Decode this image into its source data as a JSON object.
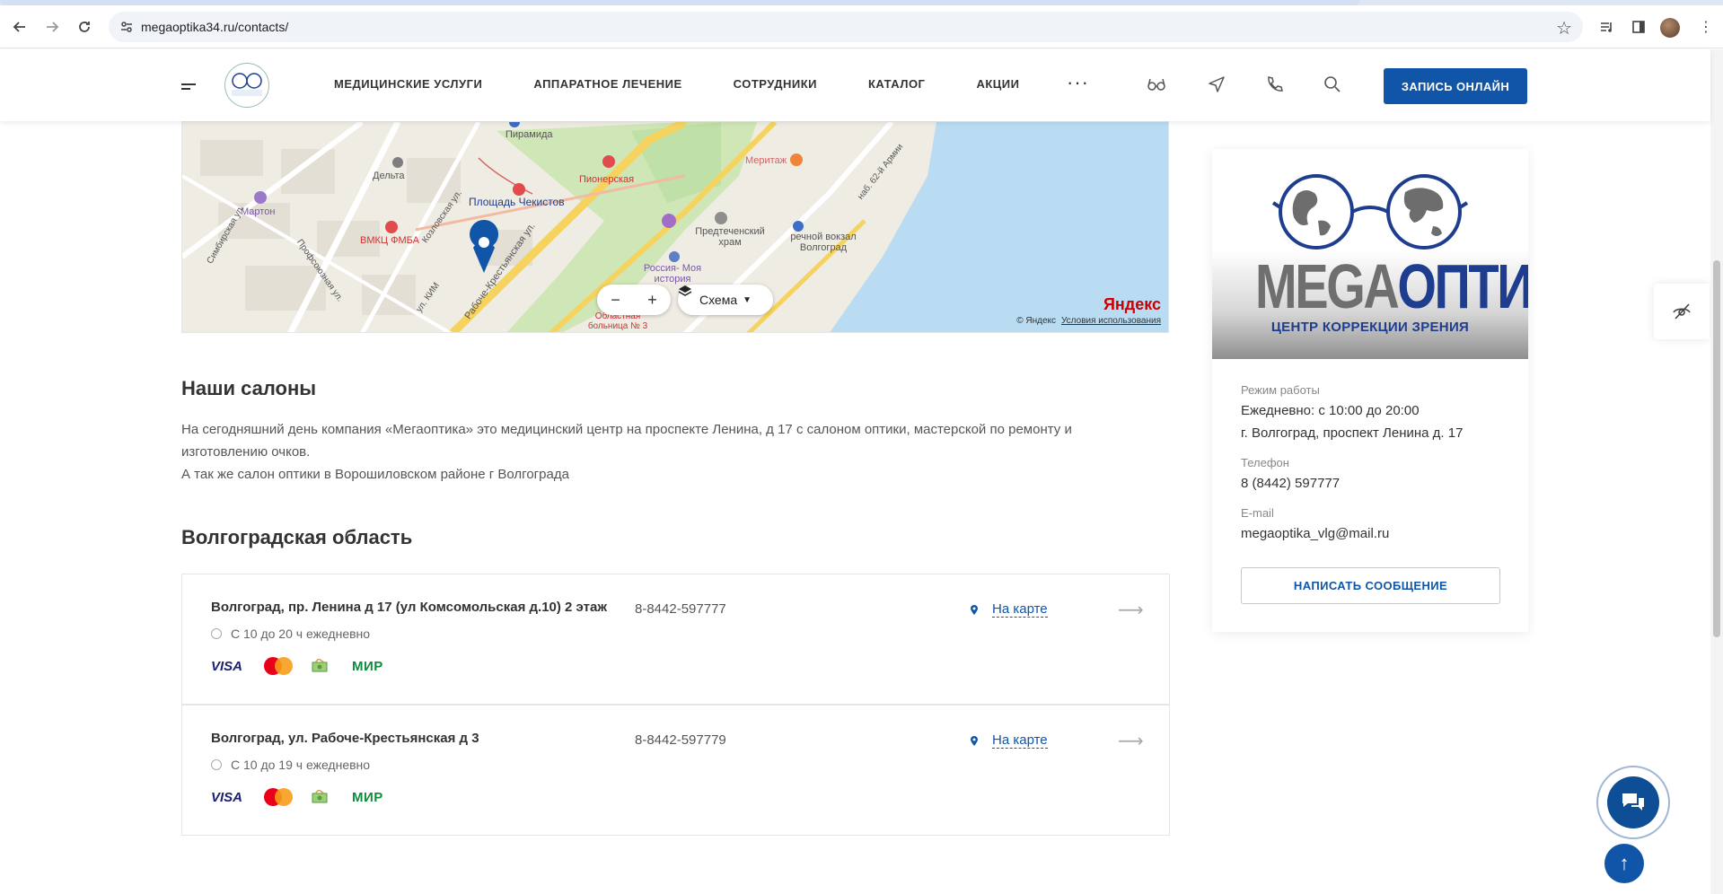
{
  "browser": {
    "url": "megaoptika34.ru/contacts/"
  },
  "header": {
    "nav": [
      "МЕДИЦИНСКИЕ УСЛУГИ",
      "АППАРАТНОЕ ЛЕЧЕНИЕ",
      "СОТРУДНИКИ",
      "КАТАЛОГ",
      "АКЦИИ"
    ],
    "more": "···",
    "cta": "ЗАПИСЬ ОНЛАЙН",
    "brand_color": "#1155a8"
  },
  "map": {
    "labels": {
      "piramida": "Пирамида",
      "delta": "Дельта",
      "pionerskaya": "Пионерская",
      "meritazh": "Меритаж",
      "martoon": "Мартон",
      "ploshad": "Площадь Чекистов",
      "vmkc": "ВМКЦ ФМБА",
      "predt": "Предтеченский храм",
      "vokzal": "речной вокзал Волгоград",
      "rossia": "Россия- Моя история",
      "bolnica": "Областная больница № 3",
      "kozlov": "Козловская ул.",
      "rab": "Рабоче-Крестьянская ул.",
      "kim": "ул. КИМ",
      "prof": "Профсоюзная ул.",
      "simb": "Симбирская ул.",
      "nab": "наб. 62-й Армии"
    },
    "zoom_out": "−",
    "zoom_in": "+",
    "scheme": "Схема",
    "yandex": "Яндекс",
    "copyright": "© Яндекс",
    "terms": "Условия использования"
  },
  "salons_section": {
    "title": "Наши салоны",
    "paragraph_1": "На сегодняшний день компания «Мегаоптика» это медицинский центр на проспекте Ленина, д 17 с салоном оптики, мастерской по ремонту и изготовлению очков.",
    "paragraph_2": "А так же салон оптики в Ворошиловском районе г Волгограда"
  },
  "region": {
    "title": "Волгоградская область",
    "salons": [
      {
        "address": "Волгоград, пр. Ленина д 17 (ул Комсомольская д.10) 2 этаж",
        "phone": "8-8442-597777",
        "hours": "С 10 до 20 ч ежедневно",
        "map_link": "На карте"
      },
      {
        "address": "Волгоград, ул. Рабоче-Крестьянская д 3",
        "phone": "8-8442-597779",
        "hours": "С 10 до 19 ч ежедневно",
        "map_link": "На карте"
      }
    ],
    "payments": [
      "VISA",
      "МИР"
    ]
  },
  "card": {
    "brand_a": "MEGA",
    "brand_b": "ОПТИКА",
    "tagline": "ЦЕНТР КОРРЕКЦИИ ЗРЕНИЯ",
    "hours_label": "Режим работы",
    "hours": "Ежедневно: с 10:00 до 20:00",
    "address": "г. Волгоград, проспект Ленина д. 17",
    "phone_label": "Телефон",
    "phone": "8 (8442) 597777",
    "email_label": "E-mail",
    "email": "megaoptika_vlg@mail.ru",
    "button": "НАПИСАТЬ СООБЩЕНИЕ"
  },
  "floating": {
    "up": "↑"
  }
}
